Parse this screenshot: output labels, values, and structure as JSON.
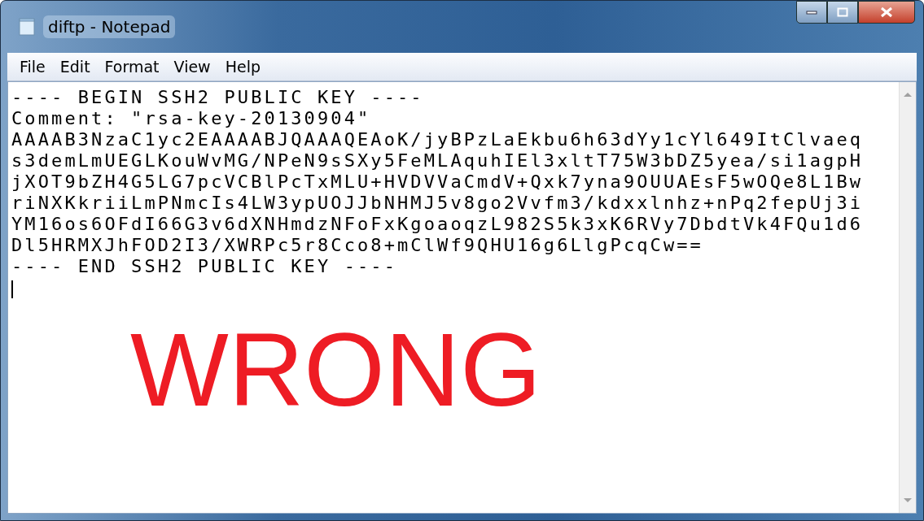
{
  "window": {
    "title": "diftp - Notepad"
  },
  "menu": [
    "File",
    "Edit",
    "Format",
    "View",
    "Help"
  ],
  "document": {
    "lines": [
      "---- BEGIN SSH2 PUBLIC KEY ----",
      "Comment: \"rsa-key-20130904\"",
      "AAAAB3NzaC1yc2EAAAABJQAAAQEAoK/jyBPzLaEkbu6h63dYy1cYl649ItClvaeq",
      "s3demLmUEGLKouWvMG/NPeN9sSXy5FeMLAquhIEl3xltT75W3bDZ5yea/si1agpH",
      "jXOT9bZH4G5LG7pcVCBlPcTxMLU+HVDVVaCmdV+Qxk7yna9OUUAEsF5wOQe8L1Bw",
      "riNXKkriiLmPNmcIs4LW3ypUOJJbNHMJ5v8go2Vvfm3/kdxxlnhz+nPq2fepUj3i",
      "YM16os6OFdI66G3v6dXNHmdzNFoFxKgoaoqzL982S5k3xK6RVy7DbdtVk4FQu1d6",
      "Dl5HRMXJhFOD2I3/XWRPc5r8Cco8+mClWf9QHU16g6LlgPcqCw==",
      "---- END SSH2 PUBLIC KEY ----"
    ]
  },
  "annotation": {
    "text": "WRONG"
  }
}
